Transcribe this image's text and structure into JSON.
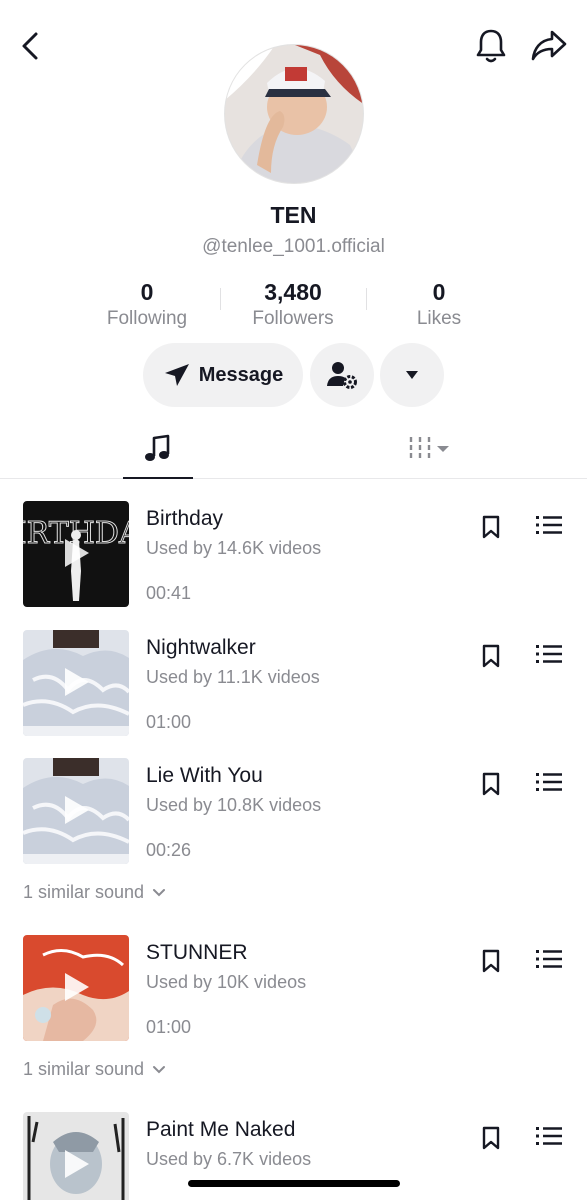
{
  "profile": {
    "name": "TEN",
    "handle": "@tenlee_1001.official",
    "stats": [
      {
        "value": "0",
        "label": "Following"
      },
      {
        "value": "3,480",
        "label": "Followers"
      },
      {
        "value": "0",
        "label": "Likes"
      }
    ]
  },
  "actions": {
    "message_label": "Message"
  },
  "tabs": {
    "active": "music-icon",
    "filter": "columns-filter-icon"
  },
  "songs": [
    {
      "title": "Birthday",
      "used": "Used by 14.6K videos",
      "duration": "00:41"
    },
    {
      "title": "Nightwalker",
      "used": "Used by 11.1K videos",
      "duration": "01:00"
    },
    {
      "title": "Lie With You",
      "used": "Used by 10.8K videos",
      "duration": "00:26",
      "similar": "1 similar sound"
    },
    {
      "title": "STUNNER",
      "used": "Used by 10K videos",
      "duration": "01:00",
      "similar": "1 similar sound"
    },
    {
      "title": "Paint Me Naked",
      "used": "Used by 6.7K videos",
      "duration": ""
    }
  ],
  "colors": {
    "text": "#161823",
    "secondary": "#8a8b91",
    "button_bg": "#f1f1f2"
  }
}
